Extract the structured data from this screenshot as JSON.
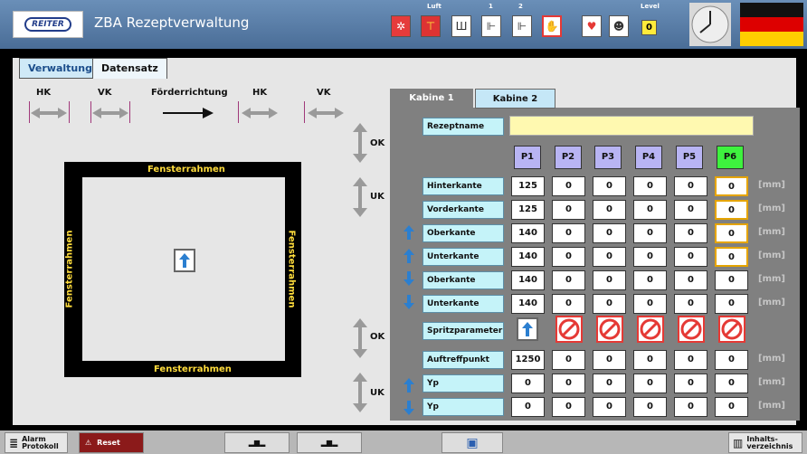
{
  "header": {
    "logo": "REITER",
    "title": "ZBA  Rezeptverwaltung",
    "small_labels": {
      "luft": "Luft",
      "one": "1",
      "two": "2",
      "level": "Level"
    },
    "level_value": "0"
  },
  "top_tabs": {
    "verwaltung": "Verwaltung",
    "datensatz": "Datensatz"
  },
  "directions": {
    "hk1": "HK",
    "vk1": "VK",
    "foerder": "Förderrichtung",
    "hk2": "HK",
    "vk2": "VK"
  },
  "frame": {
    "top": "Fensterrahmen",
    "bottom": "Fensterrahmen",
    "left": "Fensterrahmen",
    "right": "Fensterrahmen"
  },
  "section_labels": {
    "ok1": "OK",
    "uk1": "UK",
    "ok2": "OK",
    "uk2": "UK"
  },
  "cabin_tabs": {
    "k1": "Kabine 1",
    "k2": "Kabine 2"
  },
  "recipe": {
    "label": "Rezeptname",
    "value": ""
  },
  "positions": [
    "P1",
    "P2",
    "P3",
    "P4",
    "P5",
    "P6"
  ],
  "rows": [
    {
      "label": "Hinterkante",
      "values": [
        "125",
        "0",
        "0",
        "0",
        "0",
        "0"
      ],
      "unit": "[mm]"
    },
    {
      "label": "Vorderkante",
      "values": [
        "125",
        "0",
        "0",
        "0",
        "0",
        "0"
      ],
      "unit": "[mm]"
    },
    {
      "label": "Oberkante",
      "values": [
        "140",
        "0",
        "0",
        "0",
        "0",
        "0"
      ],
      "unit": "[mm]"
    },
    {
      "label": "Unterkante",
      "values": [
        "140",
        "0",
        "0",
        "0",
        "0",
        "0"
      ],
      "unit": "[mm]"
    },
    {
      "label": "Oberkante",
      "values": [
        "140",
        "0",
        "0",
        "0",
        "0",
        "0"
      ],
      "unit": "[mm]"
    },
    {
      "label": "Unterkante",
      "values": [
        "140",
        "0",
        "0",
        "0",
        "0",
        "0"
      ],
      "unit": "[mm]"
    },
    {
      "label": "Spritzparameter"
    },
    {
      "label": "Auftreffpunkt",
      "values": [
        "1250",
        "0",
        "0",
        "0",
        "0",
        "0"
      ],
      "unit": "[mm]"
    },
    {
      "label": "Yp",
      "values": [
        "0",
        "0",
        "0",
        "0",
        "0",
        "0"
      ],
      "unit": "[mm]"
    },
    {
      "label": "Yp",
      "values": [
        "0",
        "0",
        "0",
        "0",
        "0",
        "0"
      ],
      "unit": "[mm]"
    }
  ],
  "footer": {
    "alarm": "Alarm Protokoll",
    "reset": "Reset",
    "index": "Inhalts- verzeichnis"
  },
  "colors": {
    "accent_yellow": "#ffdc3c",
    "active_green": "#3ef23e",
    "param_blue": "#b8b4f3"
  }
}
